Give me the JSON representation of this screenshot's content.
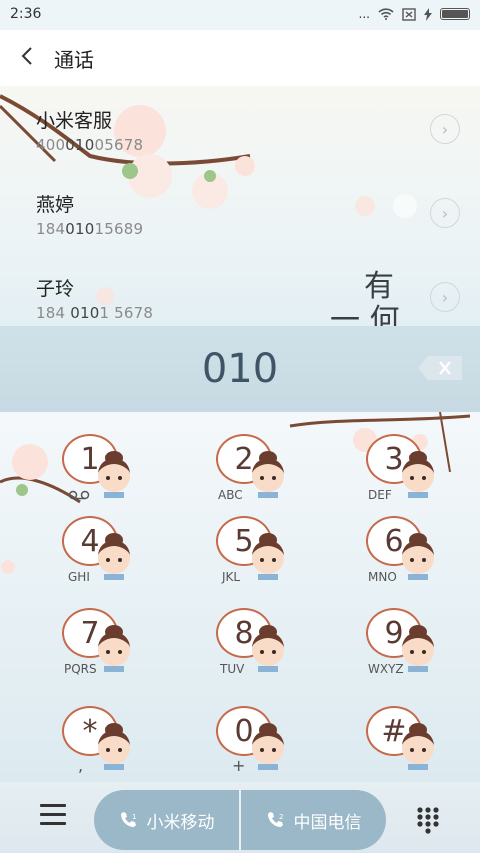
{
  "status": {
    "time": "2:36",
    "signal_text": "...",
    "icons": [
      "wifi-icon",
      "sim-off-icon",
      "charging-icon",
      "battery-icon"
    ]
  },
  "header": {
    "title": "通话"
  },
  "results": [
    {
      "name": "小米客服",
      "number_prefix": "400",
      "number_match": "010",
      "number_suffix": "05678"
    },
    {
      "name": "燕婷",
      "number_prefix": "184",
      "number_match": "010",
      "number_suffix": "15689"
    },
    {
      "name": "子玲",
      "number_prefix": "184 ",
      "number_match": "010",
      "number_suffix": "1 5678"
    }
  ],
  "calligraphy": {
    "line1": "有",
    "line2": "一 何"
  },
  "input": {
    "dialed": "010"
  },
  "keypad": [
    {
      "digit": "1",
      "letters": ""
    },
    {
      "digit": "2",
      "letters": "ABC"
    },
    {
      "digit": "3",
      "letters": "DEF"
    },
    {
      "digit": "4",
      "letters": "GHI"
    },
    {
      "digit": "5",
      "letters": "JKL"
    },
    {
      "digit": "6",
      "letters": "MNO"
    },
    {
      "digit": "7",
      "letters": "PQRS"
    },
    {
      "digit": "8",
      "letters": "TUV"
    },
    {
      "digit": "9",
      "letters": "WXYZ"
    },
    {
      "digit": "*",
      "letters": ","
    },
    {
      "digit": "0",
      "letters": "+"
    },
    {
      "digit": "#",
      "letters": ""
    }
  ],
  "bottom": {
    "sim1_label": "小米移动",
    "sim2_label": "中国电信"
  },
  "colors": {
    "accent": "#9ab8c8",
    "dialed_text": "#3e5566",
    "bubble_border": "#c56a4a"
  }
}
